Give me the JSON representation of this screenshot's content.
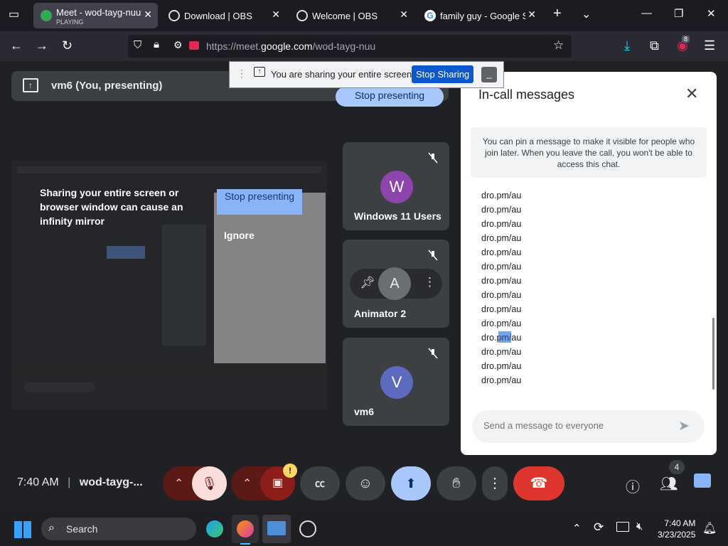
{
  "browser": {
    "tabs": [
      {
        "title": "Meet - wod-tayg-nuu",
        "status": "PLAYING",
        "active": true
      },
      {
        "title": "Download | OBS",
        "active": false
      },
      {
        "title": "Welcome | OBS",
        "active": false
      },
      {
        "title": "family guy - Google Se",
        "active": false
      }
    ],
    "url_prefix": "https://meet.",
    "url_domain": "google.com",
    "url_path": "/wod-tayg-nuu",
    "extension_badge": "8"
  },
  "share_banner": {
    "message": "You are sharing your entire screen.",
    "stop_label": "Stop Sharing"
  },
  "presenting": {
    "label": "vm6 (You, presenting)",
    "stop_label": "Stop presenting"
  },
  "mirror_warning": {
    "text": "Sharing your entire screen or browser window can cause an infinity mirror",
    "stop_label": "Stop presenting",
    "ignore_label": "Ignore"
  },
  "participants": [
    {
      "initial": "W",
      "name": "Windows 11 Users",
      "color": "#8e44ad"
    },
    {
      "initial": "A",
      "name": "Animator 2",
      "color": "#5f6368"
    },
    {
      "initial": "V",
      "name": "vm6",
      "color": "#5c6bc0"
    }
  ],
  "chat": {
    "title": "In-call messages",
    "notice": "You can pin a message to make it visible for people who join later. When you leave the call, you won't be able to access this chat.",
    "messages": [
      "dro.pm/au",
      "dro.pm/au",
      "dro.pm/au",
      "dro.pm/au",
      "dro.pm/au",
      "dro.pm/au",
      "dro.pm/au",
      "dro.pm/au",
      "dro.pm/au",
      "dro.pm/au",
      "dro.pm/au",
      "dro.pm/au",
      "dro.pm/au",
      "dro.pm/au"
    ],
    "placeholder": "Send a message to everyone"
  },
  "meeting": {
    "time": "7:40 AM",
    "code": "wod-tayg-...",
    "people_count": "4",
    "warning_badge": "!"
  },
  "taskbar": {
    "search_label": "Search",
    "time": "7:40 AM",
    "date": "3/23/2025"
  }
}
